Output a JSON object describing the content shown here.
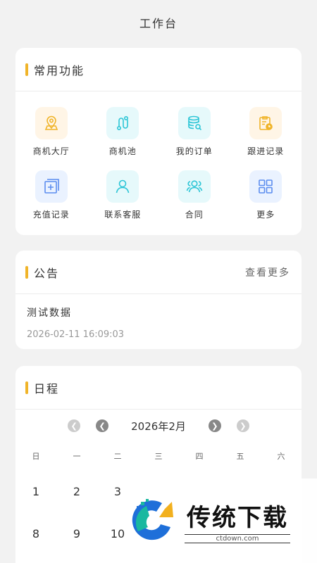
{
  "header": {
    "title": "工作台"
  },
  "common_functions": {
    "title": "常用功能",
    "items": [
      {
        "label": "商机大厅",
        "icon": "location-pin-icon"
      },
      {
        "label": "商机池",
        "icon": "route-icon"
      },
      {
        "label": "我的订单",
        "icon": "database-search-icon"
      },
      {
        "label": "跟进记录",
        "icon": "clipboard-clock-icon"
      },
      {
        "label": "充值记录",
        "icon": "plus-square-icon"
      },
      {
        "label": "联系客服",
        "icon": "user-icon"
      },
      {
        "label": "合同",
        "icon": "users-icon"
      },
      {
        "label": "更多",
        "icon": "grid-icon"
      }
    ]
  },
  "notice": {
    "title": "公告",
    "more": "查看更多",
    "item_title": "测试数据",
    "item_time": "2026-02-11  16:09:03"
  },
  "schedule": {
    "title": "日程",
    "month": "2026年2月",
    "weekdays": [
      "日",
      "一",
      "二",
      "三",
      "四",
      "五",
      "六"
    ],
    "week1": [
      "1",
      "2",
      "3",
      "",
      "",
      "",
      ""
    ],
    "week2": [
      "8",
      "9",
      "10",
      "",
      "",
      "",
      ""
    ]
  },
  "watermark": {
    "name": "传统下载",
    "url": "ctdown.com"
  },
  "colors": {
    "accent": "#f0b429",
    "icon_orange_bg": "#fff5e6",
    "icon_cyan_bg": "#e6f9fb",
    "icon_blue_bg": "#eaf2ff"
  }
}
